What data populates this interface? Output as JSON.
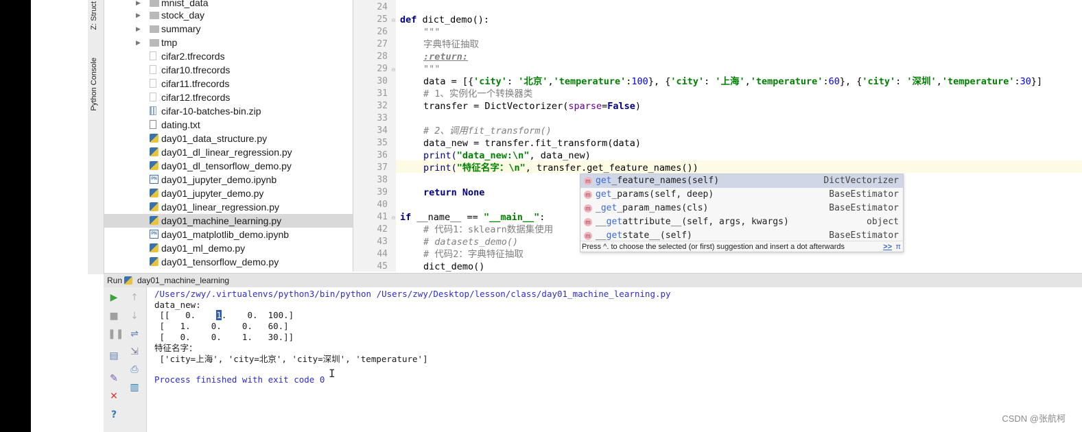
{
  "sidebar": {
    "structure_tab": "Z: Struct",
    "console_tab": "Python Console"
  },
  "project_tree": {
    "items": [
      {
        "label": "mnist_data",
        "type": "folder",
        "selected": false
      },
      {
        "label": "stock_day",
        "type": "folder",
        "selected": false
      },
      {
        "label": "summary",
        "type": "folder",
        "selected": false
      },
      {
        "label": "tmp",
        "type": "folder",
        "selected": false
      },
      {
        "label": "cifar2.tfrecords",
        "type": "file",
        "selected": false
      },
      {
        "label": "cifar10.tfrecords",
        "type": "file",
        "selected": false
      },
      {
        "label": "cifar11.tfrecords",
        "type": "file",
        "selected": false
      },
      {
        "label": "cifar12.tfrecords",
        "type": "file",
        "selected": false
      },
      {
        "label": "cifar-10-batches-bin.zip",
        "type": "zip",
        "selected": false
      },
      {
        "label": "dating.txt",
        "type": "txt",
        "selected": false
      },
      {
        "label": "day01_data_structure.py",
        "type": "py",
        "selected": false
      },
      {
        "label": "day01_dl_linear_regression.py",
        "type": "py",
        "selected": false
      },
      {
        "label": "day01_dl_tensorflow_demo.py",
        "type": "py",
        "selected": false
      },
      {
        "label": "day01_jupyter_demo.ipynb",
        "type": "ipynb",
        "selected": false
      },
      {
        "label": "day01_jupyter_demo.py",
        "type": "py",
        "selected": false
      },
      {
        "label": "day01_linear_regression.py",
        "type": "py",
        "selected": false
      },
      {
        "label": "day01_machine_learning.py",
        "type": "py",
        "selected": true
      },
      {
        "label": "day01_matplotlib_demo.ipynb",
        "type": "ipynb",
        "selected": false
      },
      {
        "label": "day01_ml_demo.py",
        "type": "py",
        "selected": false
      },
      {
        "label": "day01_tensorflow_demo.py",
        "type": "py",
        "selected": false
      }
    ]
  },
  "editor": {
    "line_numbers": [
      "24",
      "25",
      "26",
      "27",
      "28",
      "29",
      "30",
      "31",
      "32",
      "33",
      "34",
      "35",
      "36",
      "37",
      "38",
      "39",
      "40",
      "41",
      "42",
      "43",
      "44",
      "45"
    ],
    "code": {
      "l25_kw": "def",
      "l25_rest": " dict_demo():",
      "l26": "\"\"\"",
      "l27": "字典特征抽取",
      "l28": ":return:",
      "l29": "\"\"\"",
      "l30_a": "data = [{",
      "l30_s1": "'city'",
      "l30_b": ": ",
      "l30_s2": "'北京'",
      "l30_c": ",",
      "l30_s3": "'temperature'",
      "l30_d": ":",
      "l30_n1": "100",
      "l30_e": "}, {",
      "l30_s4": "'city'",
      "l30_f": ": ",
      "l30_s5": "'上海'",
      "l30_g": ",",
      "l30_s6": "'temperature'",
      "l30_h": ":",
      "l30_n2": "60",
      "l30_i": "}, {",
      "l30_s7": "'city'",
      "l30_j": ": ",
      "l30_s8": "'深圳'",
      "l30_k": ",",
      "l30_s9": "'temperature'",
      "l30_l": ":",
      "l30_n3": "30",
      "l30_m": "}]",
      "l31": "# 1、实例化一个转换器类",
      "l32_a": "transfer = DictVectorizer(",
      "l32_p": "sparse",
      "l32_b": "=",
      "l32_kw": "False",
      "l32_c": ")",
      "l34": "# 2、调用fit_transform()",
      "l35": "data_new = transfer.fit_transform(data)",
      "l36_a": "print(",
      "l36_s": "\"data_new:\\n\"",
      "l36_b": ", data_new)",
      "l37_a": "print(",
      "l37_s": "\"特征名字：\\n\"",
      "l37_b": ", transfer.get_feature_names())",
      "l39_kw1": "return",
      "l39_kw2": "None",
      "l41_kw": "if",
      "l41_a": " __name__ == ",
      "l41_s": "\"__main__\"",
      "l41_b": ":",
      "l42": "# 代码1：sklearn数据集使用",
      "l43": "# datasets_demo()",
      "l44": "# 代码2：字典特征抽取",
      "l45": "dict_demo()"
    }
  },
  "autocomplete": {
    "items": [
      {
        "match": "get",
        "name": "_feature_names(self)",
        "prefix": "",
        "cls": "DictVectorizer",
        "selected": true
      },
      {
        "match": "get",
        "name": "_params(self, deep)",
        "prefix": "",
        "cls": "BaseEstimator",
        "selected": false
      },
      {
        "match": "get",
        "name": "_param_names(cls)",
        "prefix": "_",
        "cls": "BaseEstimator",
        "selected": false
      },
      {
        "match": "get",
        "name": "attribute__(self, args, kwargs)",
        "prefix": "__",
        "cls": "object",
        "selected": false
      },
      {
        "match": "get",
        "name": "state__(self)",
        "prefix": "__",
        "cls": "BaseEstimator",
        "selected": false
      }
    ],
    "icon_letter": "m",
    "hint": "Press ^. to choose the selected (or first) suggestion and insert a dot afterwards",
    "more": ">>",
    "pi": "π"
  },
  "run_panel": {
    "run_label": "Run",
    "tab_label": "day01_machine_learning"
  },
  "console": {
    "command": "/Users/zwy/.virtualenvs/python3/bin/python /Users/zwy/Desktop/lesson/class/day01_machine_learning.py",
    "data_new_label": "data_new:",
    "matrix_row1_a": " [[   0.    ",
    "matrix_row1_sel": "1",
    "matrix_row1_b": ".    0.  100.]",
    "matrix_row2": " [   1.    0.    0.   60.]",
    "matrix_row3": " [   0.    0.    1.   30.]]",
    "feature_label": "特征名字：",
    "feature_list": " ['city=上海', 'city=北京', 'city=深圳', 'temperature']",
    "exit": "Process finished with exit code 0"
  },
  "watermark": "CSDN @张航柯"
}
